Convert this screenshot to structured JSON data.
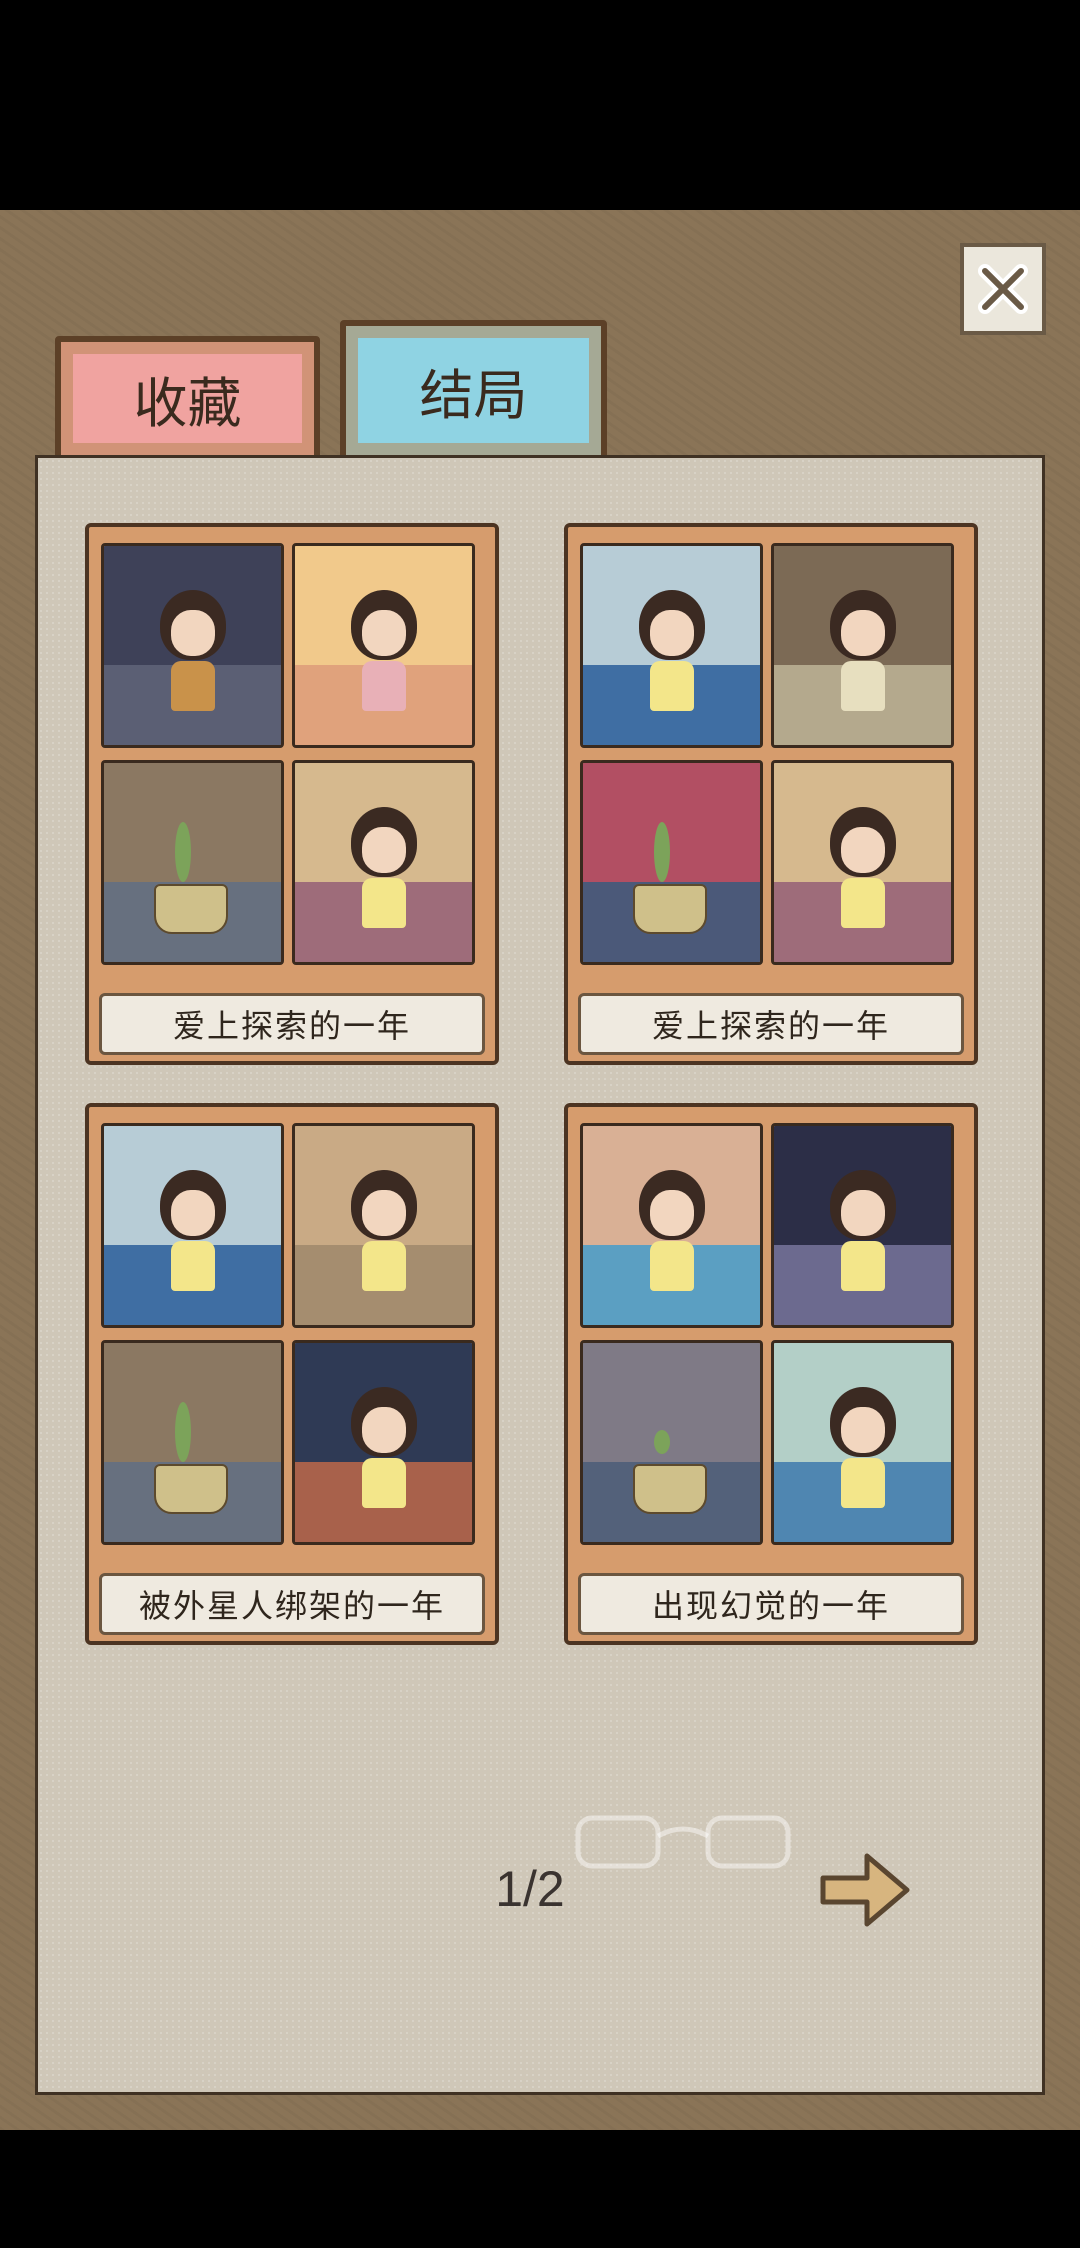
{
  "tabs": {
    "collection": "收藏",
    "ending": "结局"
  },
  "endings": [
    {
      "title": "爱上探索的一年"
    },
    {
      "title": "爱上探索的一年"
    },
    {
      "title": "被外星人绑架的一年"
    },
    {
      "title": "出现幻觉的一年"
    }
  ],
  "pagination": {
    "label": "1/2"
  },
  "icons": {
    "close": "close-icon",
    "next": "arrow-right-icon"
  },
  "colors": {
    "tab_collection": "#f0a3a0",
    "tab_ending": "#8fd3e3",
    "card_frame": "#d69c6d",
    "panel": "#cfc7b8"
  }
}
